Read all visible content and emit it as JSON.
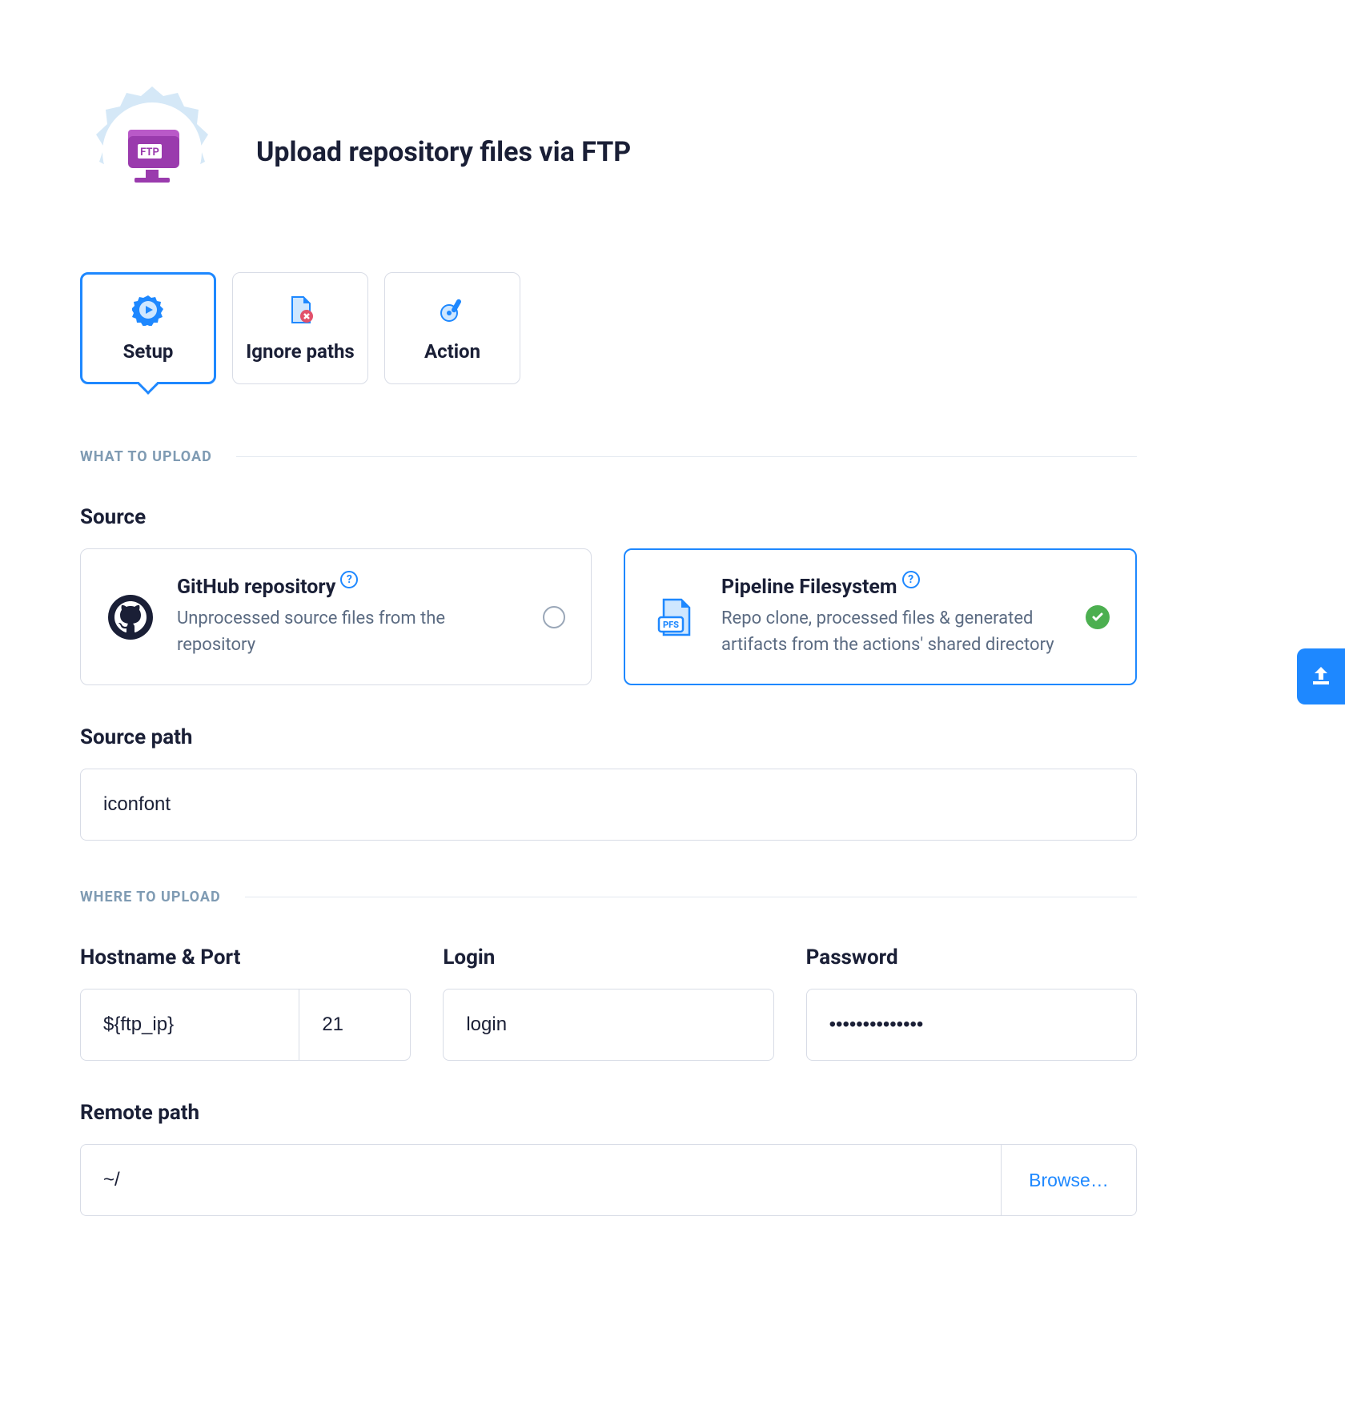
{
  "header": {
    "title": "Upload repository files via FTP",
    "ftp_badge_text": "FTP"
  },
  "tabs": [
    {
      "label": "Setup",
      "active": true
    },
    {
      "label": "Ignore paths",
      "active": false
    },
    {
      "label": "Action",
      "active": false
    }
  ],
  "sections": {
    "what_to_upload": "WHAT TO UPLOAD",
    "where_to_upload": "WHERE TO UPLOAD"
  },
  "source": {
    "label": "Source",
    "options": {
      "github": {
        "title": "GitHub repository",
        "desc": "Unprocessed source files from the repository",
        "selected": false
      },
      "pipeline": {
        "title": "Pipeline Filesystem",
        "desc": "Repo clone, processed files & generated artifacts from the actions' shared directory",
        "selected": true,
        "pfs_label": "PFS"
      }
    }
  },
  "source_path": {
    "label": "Source path",
    "value": "iconfont"
  },
  "hostname_port": {
    "label": "Hostname & Port",
    "hostname": "${ftp_ip}",
    "port": "21"
  },
  "login": {
    "label": "Login",
    "value": "login"
  },
  "password": {
    "label": "Password",
    "value": "••••••••••••••"
  },
  "remote_path": {
    "label": "Remote path",
    "value": "~/",
    "browse_label": "Browse…"
  },
  "help_symbol": "?"
}
